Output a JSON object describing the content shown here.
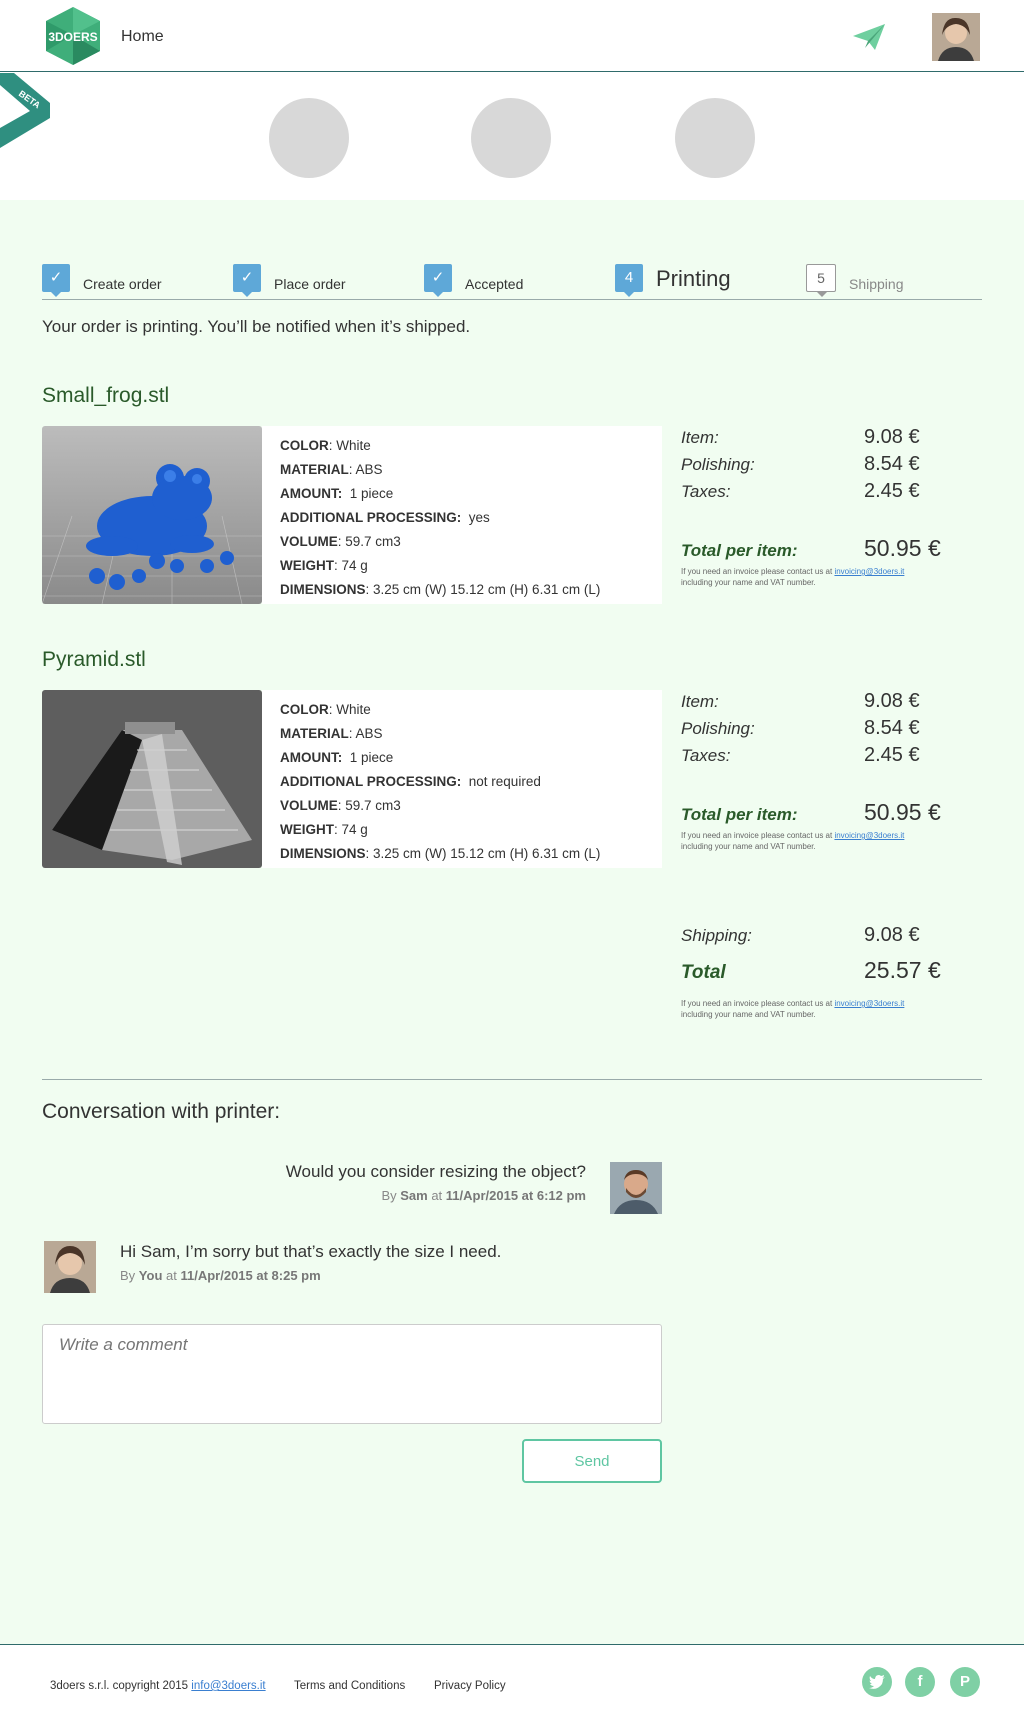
{
  "header": {
    "logo_text": "3DOERS",
    "home_label": "Home"
  },
  "beta_label": "BETA",
  "steps": [
    {
      "label": "Create order",
      "state": "done"
    },
    {
      "label": "Place order",
      "state": "done"
    },
    {
      "label": "Accepted",
      "state": "done"
    },
    {
      "label": "Printing",
      "number": "4",
      "state": "active"
    },
    {
      "label": "Shipping",
      "number": "5",
      "state": "pending"
    }
  ],
  "status_message": "Your order is printing. You’ll be notified when it’s shipped.",
  "items": [
    {
      "name": "Small_frog.stl",
      "specs": {
        "color_label": "COLOR",
        "color": "White",
        "material_label": "MATERIAL",
        "material": "ABS",
        "amount_label": "AMOUNT:",
        "amount": "1 piece",
        "processing_label": "ADDITIONAL PROCESSING:",
        "processing": "yes",
        "volume_label": "VOLUME",
        "volume": "59.7 cm3",
        "weight_label": "WEIGHT",
        "weight": "74 g",
        "dimensions_label": "DIMENSIONS",
        "dimensions": "3.25 cm (W) 15.12 cm (H) 6.31 cm (L)"
      },
      "pricing": {
        "item_label": "Item:",
        "item": "9.08 €",
        "polishing_label": "Polishing:",
        "polishing": "8.54 €",
        "taxes_label": "Taxes:",
        "taxes": "2.45 €",
        "total_label": "Total per item:",
        "total": "50.95 €"
      }
    },
    {
      "name": "Pyramid.stl",
      "specs": {
        "color_label": "COLOR",
        "color": "White",
        "material_label": "MATERIAL",
        "material": "ABS",
        "amount_label": "AMOUNT:",
        "amount": "1 piece",
        "processing_label": "ADDITIONAL PROCESSING:",
        "processing": "not required",
        "volume_label": "VOLUME",
        "volume": "59.7 cm3",
        "weight_label": "WEIGHT",
        "weight": "74 g",
        "dimensions_label": "DIMENSIONS",
        "dimensions": "3.25 cm (W) 15.12 cm (H) 6.31 cm (L)"
      },
      "pricing": {
        "item_label": "Item:",
        "item": "9.08 €",
        "polishing_label": "Polishing:",
        "polishing": "8.54 €",
        "taxes_label": "Taxes:",
        "taxes": "2.45 €",
        "total_label": "Total per item:",
        "total": "50.95 €"
      }
    }
  ],
  "invoice_note_pre": "If you need an invoice please contact us at ",
  "invoice_email": "invoicing@3doers.it",
  "invoice_note_post": "including your name and VAT number.",
  "summary": {
    "shipping_label": "Shipping:",
    "shipping": "9.08 €",
    "total_label": "Total",
    "total": "25.57 €"
  },
  "conversation": {
    "title": "Conversation with printer:",
    "messages": [
      {
        "text": "Would you consider resizing the object?",
        "by": "By",
        "author": "Sam",
        "at": "at",
        "date": "11/Apr/2015 at 6:12 pm"
      },
      {
        "text": "Hi Sam, I’m sorry but that’s exactly the size I need.",
        "by": "By",
        "author": "You",
        "at": "at",
        "date": "11/Apr/2015 at 8:25 pm"
      }
    ],
    "comment_placeholder": "Write a comment",
    "send_label": "Send"
  },
  "footer": {
    "copyright": "3doers s.r.l. copyright 2015",
    "email": "info@3doers.it",
    "terms": "Terms and Conditions",
    "privacy": "Privacy Policy"
  },
  "colors": {
    "accent": "#5fc6a2",
    "step_blue": "#5ea8d8",
    "background": "#f1fdf1"
  }
}
